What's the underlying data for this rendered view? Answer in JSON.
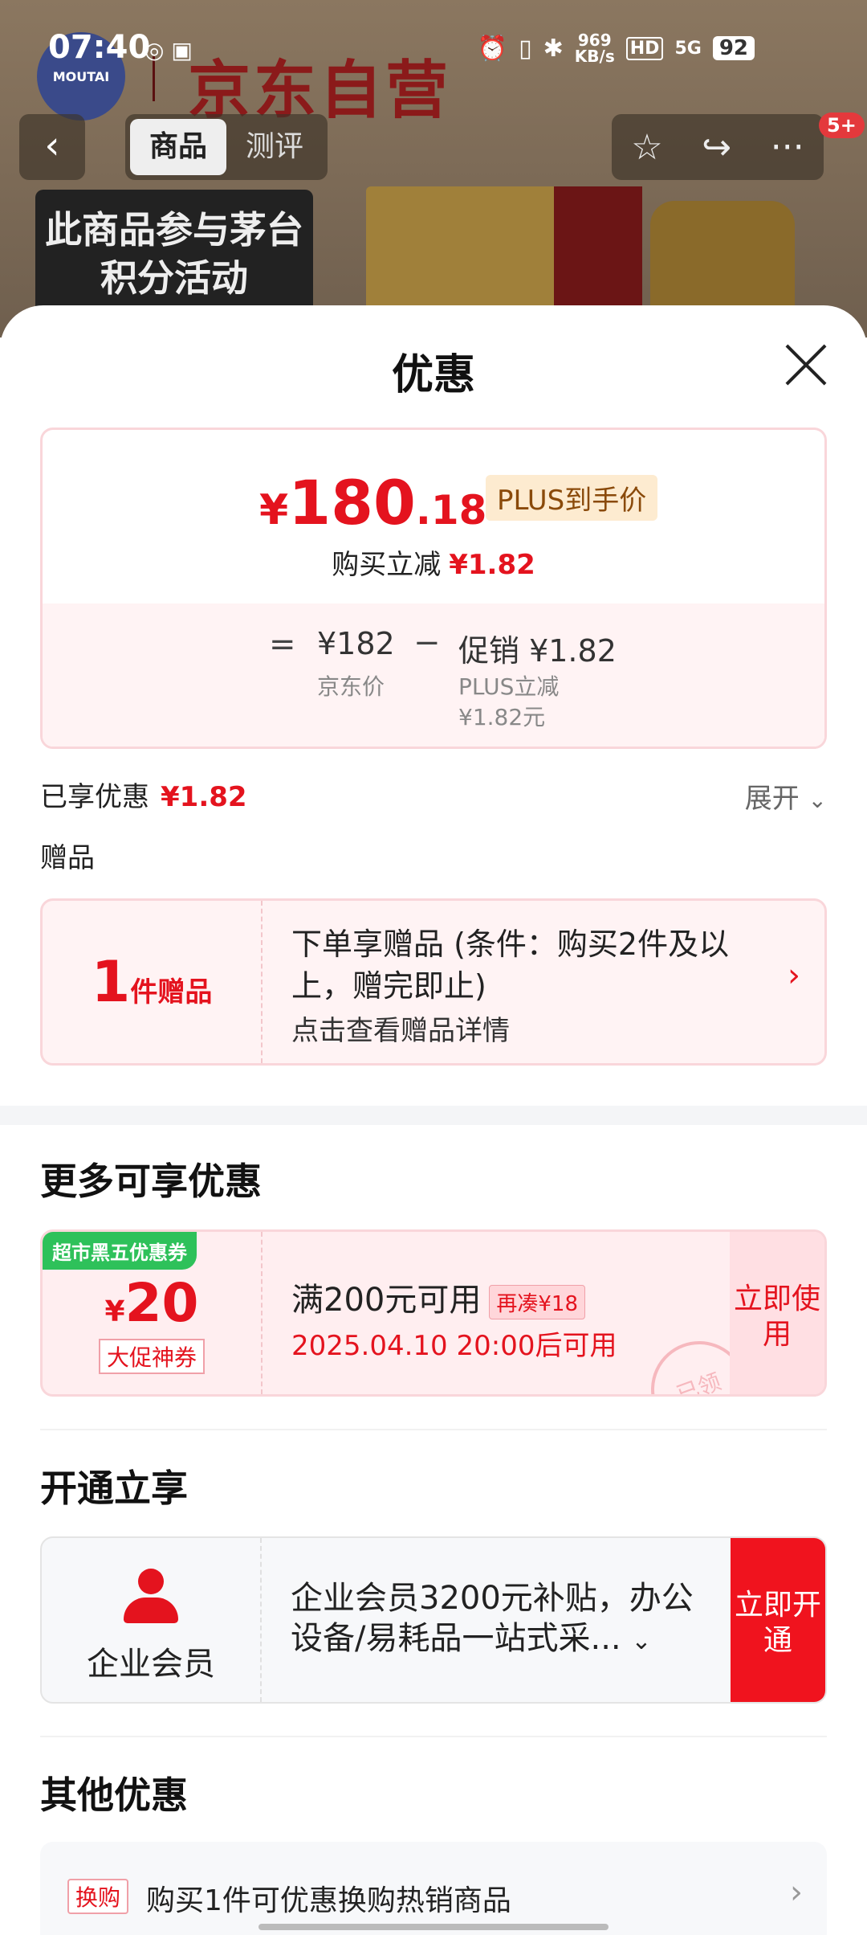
{
  "status_bar": {
    "time": "07:40",
    "net_speed_value": "969",
    "net_speed_unit": "KB/s",
    "hd": "HD",
    "signal": "5G",
    "battery": "92"
  },
  "background": {
    "logo_text": "MOUTAI",
    "brand_text": "京东自营",
    "promo_text": "此商品参与茅台积分活动"
  },
  "nav": {
    "back_icon": "chevron-left",
    "tabs": [
      {
        "label": "商品",
        "active": true
      },
      {
        "label": "测评",
        "active": false
      }
    ],
    "badge": "5+"
  },
  "sheet": {
    "title": "优惠",
    "price": {
      "currency": "¥",
      "integer": "180",
      "decimal": ".18",
      "tag": "PLUS到手价",
      "instant_label": "购买立减",
      "instant_amount": "¥1.82",
      "breakdown": {
        "equals": "=",
        "jd_price": "¥182",
        "jd_price_label": "京东价",
        "minus": "−",
        "promo_label": "促销 ¥1.82",
        "plus_label": "PLUS立减",
        "plus_amount": "¥1.82元"
      }
    },
    "enjoyed": {
      "label": "已享优惠",
      "amount": "¥1.82",
      "expand": "展开"
    },
    "gift": {
      "section_label": "赠品",
      "count": "1",
      "unit": "件赠品",
      "description": "下单享赠品 (条件：购买2件及以上，赠完即止)",
      "detail_link": "点击查看赠品详情"
    },
    "more": {
      "title": "更多可享优惠",
      "coupon": {
        "ribbon": "超市黑五优惠券",
        "currency": "¥",
        "amount": "20",
        "tag": "大促神券",
        "condition": "满200元可用",
        "need_more": "再凑¥18",
        "valid_time": "2025.04.10 20:00后可用",
        "action": "立即使用",
        "stamp": "已领"
      }
    },
    "membership": {
      "title": "开通立享",
      "label": "企业会员",
      "description": "企业会员3200元补贴，办公设备/易耗品一站式采...",
      "action": "立即开通"
    },
    "other": {
      "title": "其他优惠",
      "tag": "换购",
      "text": "购买1件可优惠换购热销商品"
    }
  }
}
